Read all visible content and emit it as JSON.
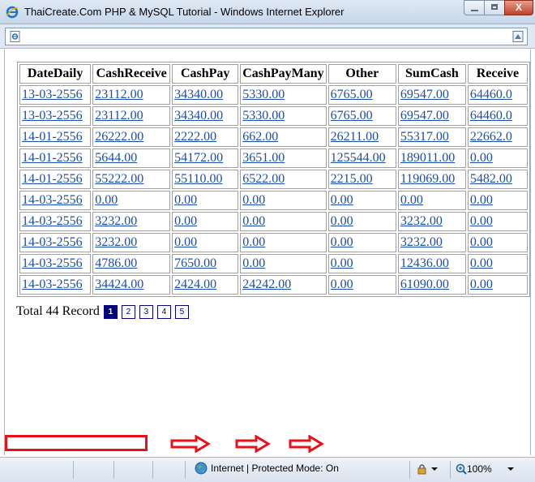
{
  "window": {
    "title": "ThaiCreate.Com PHP & MySQL Tutorial - Windows Internet Explorer",
    "close_glyph": "X"
  },
  "table": {
    "headers": [
      "DateDaily",
      "CashReceive",
      "CashPay",
      "CashPayMany",
      "Other",
      "SumCash",
      "Receive"
    ],
    "rows": [
      [
        "13-03-2556",
        "23112.00",
        "34340.00",
        "5330.00",
        "6765.00",
        "69547.00",
        "64460.0"
      ],
      [
        "13-03-2556",
        "23112.00",
        "34340.00",
        "5330.00",
        "6765.00",
        "69547.00",
        "64460.0"
      ],
      [
        "14-01-2556",
        "26222.00",
        "2222.00",
        "662.00",
        "26211.00",
        "55317.00",
        "22662.0"
      ],
      [
        "14-01-2556",
        "5644.00",
        "54172.00",
        "3651.00",
        "125544.00",
        "189011.00",
        "0.00"
      ],
      [
        "14-01-2556",
        "55222.00",
        "55110.00",
        "6522.00",
        "2215.00",
        "119069.00",
        "5482.00"
      ],
      [
        "14-03-2556",
        "0.00",
        "0.00",
        "0.00",
        "0.00",
        "0.00",
        "0.00"
      ],
      [
        "14-03-2556",
        "3232.00",
        "0.00",
        "0.00",
        "0.00",
        "3232.00",
        "0.00"
      ],
      [
        "14-03-2556",
        "3232.00",
        "0.00",
        "0.00",
        "0.00",
        "3232.00",
        "0.00"
      ],
      [
        "14-03-2556",
        "4786.00",
        "7650.00",
        "0.00",
        "0.00",
        "12436.00",
        "0.00"
      ],
      [
        "14-03-2556",
        "34424.00",
        "2424.00",
        "24242.00",
        "0.00",
        "61090.00",
        "0.00"
      ]
    ]
  },
  "pager": {
    "label": "Total 44 Record",
    "pages": [
      "1",
      "2",
      "3",
      "4",
      "5"
    ],
    "current": "1"
  },
  "statusbar": {
    "zone": "Internet | Protected Mode: On",
    "zoom": "100%"
  },
  "colors": {
    "link": "#1a4fb0",
    "pager_active": "#000080",
    "annotation_red": "#e8101a"
  }
}
